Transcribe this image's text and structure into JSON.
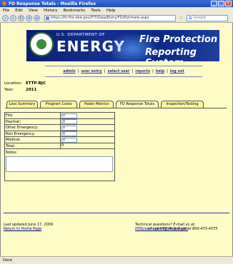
{
  "window": {
    "title": "FD Response Totals - Mozilla Firefox"
  },
  "menu": [
    "File",
    "Edit",
    "View",
    "History",
    "Bookmarks",
    "Tools",
    "Help"
  ],
  "browser": {
    "url": "https://ftr.fire.doe.gov/FIT/Data/Entry/FD/Estimate.aspx",
    "search_placeholder": "Google"
  },
  "banner": {
    "dept": "U.S. DEPARTMENT OF",
    "org": "ENERGY",
    "title1": "Fire Protection",
    "title2": "Reporting System"
  },
  "nav": [
    "admin",
    "user entry",
    "select user",
    "reports",
    "help",
    "log out"
  ],
  "site": {
    "location_label": "Location:",
    "location": "ETTP-BJC",
    "year_label": "Year:",
    "year": "2011"
  },
  "tabs": [
    "Loss Summary",
    "Program Costs",
    "Halon Metrics",
    "FD Response Totals",
    "Inspection/Testing"
  ],
  "form": {
    "rows": [
      {
        "label": "Fire:",
        "value": "0"
      },
      {
        "label": "Hazmat:",
        "value": "0"
      },
      {
        "label": "Other Emergency:",
        "value": "0"
      },
      {
        "label": "Non Emergency:",
        "value": "0"
      },
      {
        "label": "Medical:",
        "value": "0"
      }
    ],
    "total_label": "Total:",
    "total": "0",
    "notes_label": "Notes:"
  },
  "footer": {
    "updated": "Last updated June 17, 2009",
    "home": "Return to Home Page",
    "q1": "Technical questions? E-mail us at:",
    "email": "HSSUserSupport@eh.doe.gov",
    "q2": "or call HSS Help Desk at 800-473-4375"
  },
  "statusbar": {
    "text": "Done"
  }
}
